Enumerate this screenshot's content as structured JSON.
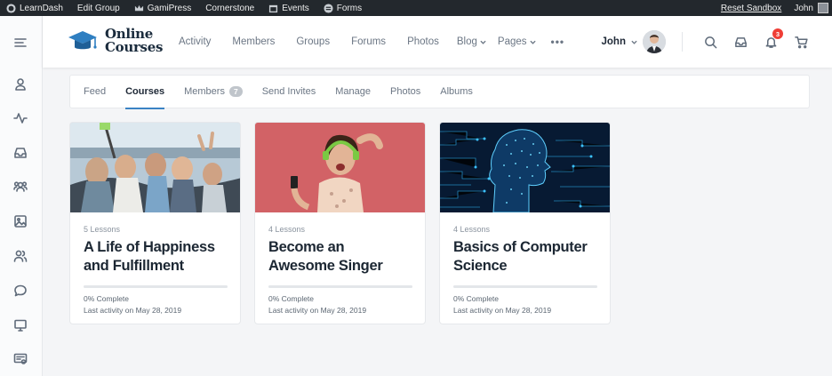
{
  "admin_bar": {
    "items": [
      {
        "label": "LearnDash",
        "icon": "wordpress-icon"
      },
      {
        "label": "Edit Group",
        "icon": ""
      },
      {
        "label": "GamiPress",
        "icon": "crown-icon"
      },
      {
        "label": "Cornerstone",
        "icon": ""
      },
      {
        "label": "Events",
        "icon": "calendar-icon"
      },
      {
        "label": "Forms",
        "icon": "forms-icon"
      }
    ],
    "reset": "Reset Sandbox",
    "user": "John"
  },
  "header": {
    "logo_line1": "Online",
    "logo_line2": "Courses",
    "nav": [
      "Activity",
      "Members",
      "Groups",
      "Forums",
      "Photos",
      "Blog",
      "Pages"
    ],
    "more": "•••",
    "user_name": "John",
    "notification_count": "3"
  },
  "tabs": [
    {
      "label": "Feed"
    },
    {
      "label": "Courses"
    },
    {
      "label": "Members",
      "count": "7"
    },
    {
      "label": "Send Invites"
    },
    {
      "label": "Manage"
    },
    {
      "label": "Photos"
    },
    {
      "label": "Albums"
    }
  ],
  "courses": [
    {
      "lessons": "5 Lessons",
      "title": "A Life of Happiness and Fulfillment",
      "progress_percent": 0,
      "complete": "0% Complete",
      "activity": "Last activity on May 28, 2019"
    },
    {
      "lessons": "4 Lessons",
      "title": "Become an Awesome Singer",
      "progress_percent": 0,
      "complete": "0% Complete",
      "activity": "Last activity on May 28, 2019"
    },
    {
      "lessons": "4 Lessons",
      "title": "Basics of Computer Science",
      "progress_percent": 0,
      "complete": "0% Complete",
      "activity": "Last activity on May 28, 2019"
    }
  ],
  "colors": {
    "accent": "#3b82c4",
    "badge": "#ef3e36",
    "admin_bar": "#23282d"
  }
}
